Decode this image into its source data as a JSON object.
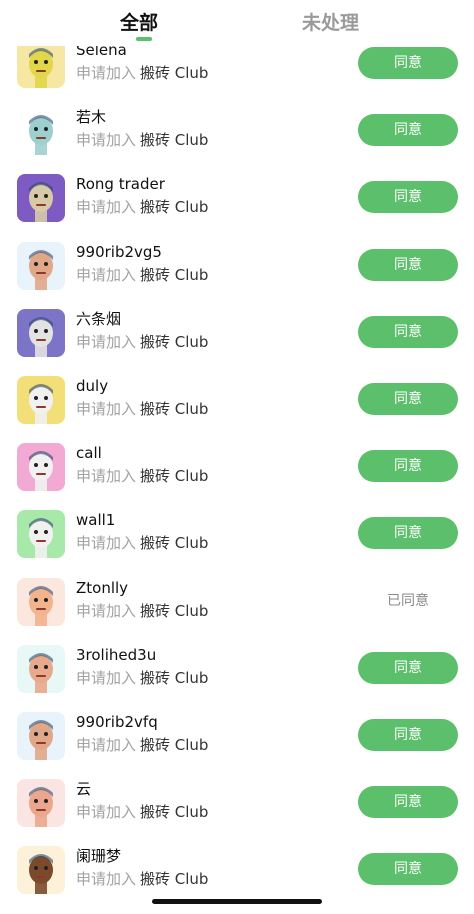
{
  "tabs": {
    "all": "全部",
    "pending": "未处理"
  },
  "items": [
    {
      "name": "Selena",
      "request": "申请加入",
      "club": "搬砖 Club",
      "action": "同意",
      "status": "pending",
      "bg": "#f6e7a2",
      "face": "#e2d64a"
    },
    {
      "name": "若木",
      "request": "申请加入",
      "club": "搬砖 Club",
      "action": "同意",
      "status": "pending",
      "bg": "#ffffff",
      "face": "#9ecfcf"
    },
    {
      "name": "Rong trader",
      "request": "申请加入",
      "club": "搬砖 Club",
      "action": "同意",
      "status": "pending",
      "bg": "#7e5bc2",
      "face": "#d8c9a8"
    },
    {
      "name": "990rib2vg5",
      "request": "申请加入",
      "club": "搬砖 Club",
      "action": "同意",
      "status": "pending",
      "bg": "#e8f3fb",
      "face": "#e1a789"
    },
    {
      "name": "六条烟",
      "request": "申请加入",
      "club": "搬砖 Club",
      "action": "同意",
      "status": "pending",
      "bg": "#7b74c7",
      "face": "#e3e3e3"
    },
    {
      "name": "duly",
      "request": "申请加入",
      "club": "搬砖 Club",
      "action": "同意",
      "status": "pending",
      "bg": "#f3df77",
      "face": "#f1f1f1"
    },
    {
      "name": "call",
      "request": "申请加入",
      "club": "搬砖 Club",
      "action": "同意",
      "status": "pending",
      "bg": "#f2a9d3",
      "face": "#f1f1f1"
    },
    {
      "name": "wall1",
      "request": "申请加入",
      "club": "搬砖 Club",
      "action": "同意",
      "status": "pending",
      "bg": "#a8e8a8",
      "face": "#f1f1f1"
    },
    {
      "name": "Ztonlly",
      "request": "申请加入",
      "club": "搬砖 Club",
      "action": "已同意",
      "status": "accepted",
      "bg": "#fbe7de",
      "face": "#f2b48f"
    },
    {
      "name": "3rolihed3u",
      "request": "申请加入",
      "club": "搬砖 Club",
      "action": "同意",
      "status": "pending",
      "bg": "#e8f8f6",
      "face": "#e8a98d"
    },
    {
      "name": "990rib2vfq",
      "request": "申请加入",
      "club": "搬砖 Club",
      "action": "同意",
      "status": "pending",
      "bg": "#e8f3fb",
      "face": "#e1a789"
    },
    {
      "name": "云",
      "request": "申请加入",
      "club": "搬砖 Club",
      "action": "同意",
      "status": "pending",
      "bg": "#fbe5e2",
      "face": "#eaa78d"
    },
    {
      "name": "阑珊梦",
      "request": "申请加入",
      "club": "搬砖 Club",
      "action": "同意",
      "status": "pending",
      "bg": "#fdf2d9",
      "face": "#7a4a2b"
    }
  ]
}
